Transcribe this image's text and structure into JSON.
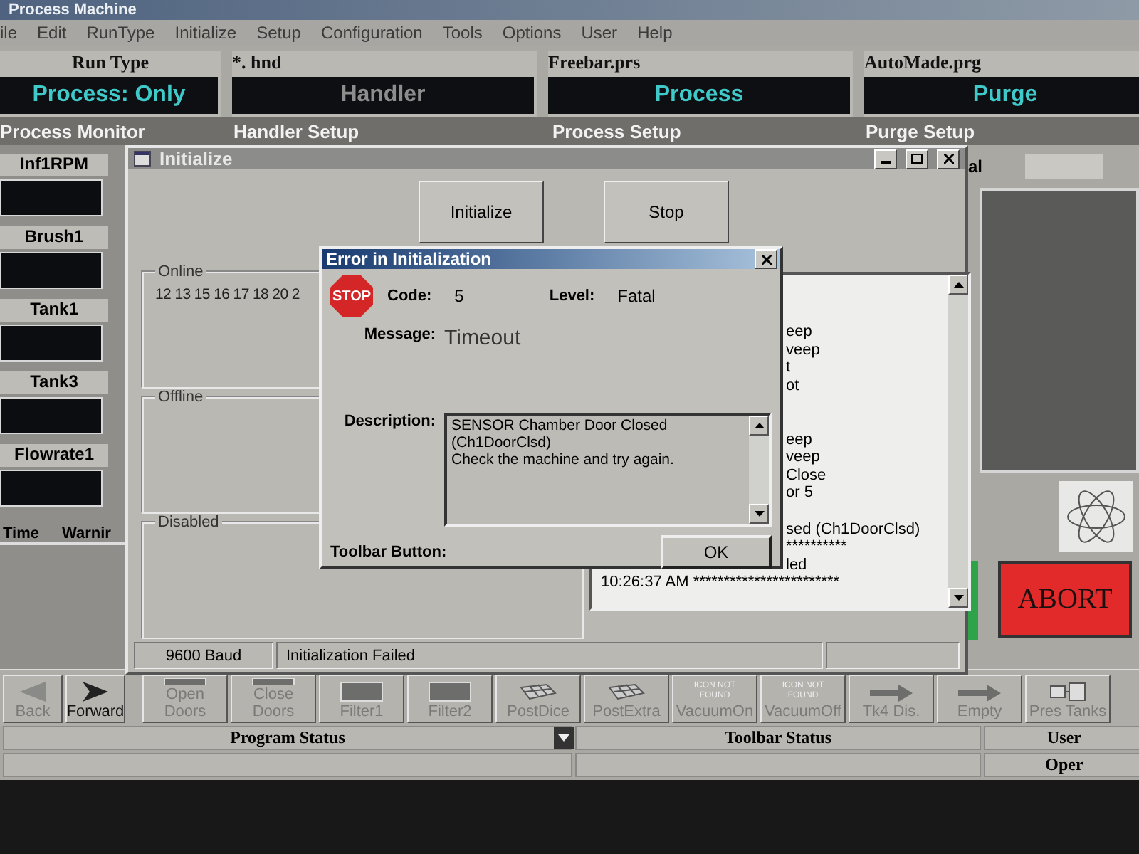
{
  "window": {
    "title": "Process Machine"
  },
  "menu": [
    "ile",
    "Edit",
    "RunType",
    "Initialize",
    "Setup",
    "Configuration",
    "Tools",
    "Options",
    "User",
    "Help"
  ],
  "header": [
    {
      "label": "Run Type",
      "value": "Process: Only",
      "disabled": false
    },
    {
      "label": "*. hnd",
      "value": "Handler",
      "disabled": true
    },
    {
      "label": "Freebar.prs",
      "value": "Process",
      "disabled": false
    },
    {
      "label": "AutoMade.prg",
      "value": "Purge",
      "disabled": false
    }
  ],
  "sections": [
    "Process Monitor",
    "Handler Setup",
    "Process Setup",
    "Purge Setup"
  ],
  "monitor": [
    "Inf1RPM",
    "Brush1",
    "Tank1",
    "Tank3",
    "Flowrate1"
  ],
  "monitor_columns": [
    "Time",
    "Warnir"
  ],
  "right_label": "al",
  "abort": "ABORT",
  "initialize_window": {
    "title": "Initialize",
    "buttons": [
      "Initialize",
      "Stop"
    ],
    "groups": [
      {
        "label": "Online",
        "text": "12 13 15 16 17 18 20 2"
      },
      {
        "label": "Offline"
      },
      {
        "label": "Disabled"
      }
    ],
    "log": [
      {
        "kind": "cut",
        "text": "eep"
      },
      {
        "kind": "cut",
        "text": "veep"
      },
      {
        "kind": "cut",
        "text": "t"
      },
      {
        "kind": "cut",
        "text": "ot"
      },
      {
        "kind": "gap"
      },
      {
        "kind": "gap"
      },
      {
        "kind": "cut",
        "text": "eep"
      },
      {
        "kind": "cut",
        "text": "veep"
      },
      {
        "kind": "cut",
        "text": "Close"
      },
      {
        "kind": "cut",
        "text": "or 5"
      },
      {
        "kind": "gap"
      },
      {
        "kind": "cut",
        "text": "sed (Ch1DoorClsd)"
      },
      {
        "kind": "cut",
        "text": "**********"
      },
      {
        "kind": "cut",
        "text": "led"
      },
      {
        "kind": "full",
        "text": "10:26:37 AM ************************"
      }
    ],
    "status": [
      "9600 Baud",
      "Initialization Failed"
    ]
  },
  "error_dialog": {
    "title": "Error in Initialization",
    "icon_text": "STOP",
    "code_label": "Code:",
    "code": "5",
    "level_label": "Level:",
    "level": "Fatal",
    "message_label": "Message:",
    "message": "Timeout",
    "description_label": "Description:",
    "description": [
      "SENSOR Chamber Door Closed",
      "(Ch1DoorClsd)",
      "Check the machine and try again."
    ],
    "toolbar_label": "Toolbar Button:",
    "ok": "OK"
  },
  "toolbar": {
    "items": [
      {
        "kind": "back",
        "label": "Back",
        "disabled": true
      },
      {
        "kind": "forward",
        "label": "Forward",
        "disabled": false
      },
      {
        "kind": "box",
        "label": "Open Doors",
        "disabled": true
      },
      {
        "kind": "box",
        "label": "Close Doors",
        "disabled": true
      },
      {
        "kind": "box",
        "label": "Filter1",
        "disabled": true
      },
      {
        "kind": "box",
        "label": "Filter2",
        "disabled": true
      },
      {
        "kind": "grid",
        "label": "PostDice",
        "disabled": true
      },
      {
        "kind": "grid",
        "label": "PostExtra",
        "disabled": true
      },
      {
        "kind": "missing",
        "icon_text": "ICON NOT FOUND",
        "label": "VacuumOn",
        "disabled": true
      },
      {
        "kind": "missing",
        "icon_text": "ICON NOT FOUND",
        "label": "VacuumOff",
        "disabled": true
      },
      {
        "kind": "arrow",
        "label": "Tk4 Dis.",
        "disabled": true
      },
      {
        "kind": "arrow",
        "label": "Empty",
        "disabled": true
      },
      {
        "kind": "tank",
        "label": "Pres Tanks",
        "disabled": true
      }
    ]
  },
  "status_bar": {
    "program": "Program Status",
    "toolbar": "Toolbar Status",
    "user_label": "User",
    "user": "Oper"
  }
}
